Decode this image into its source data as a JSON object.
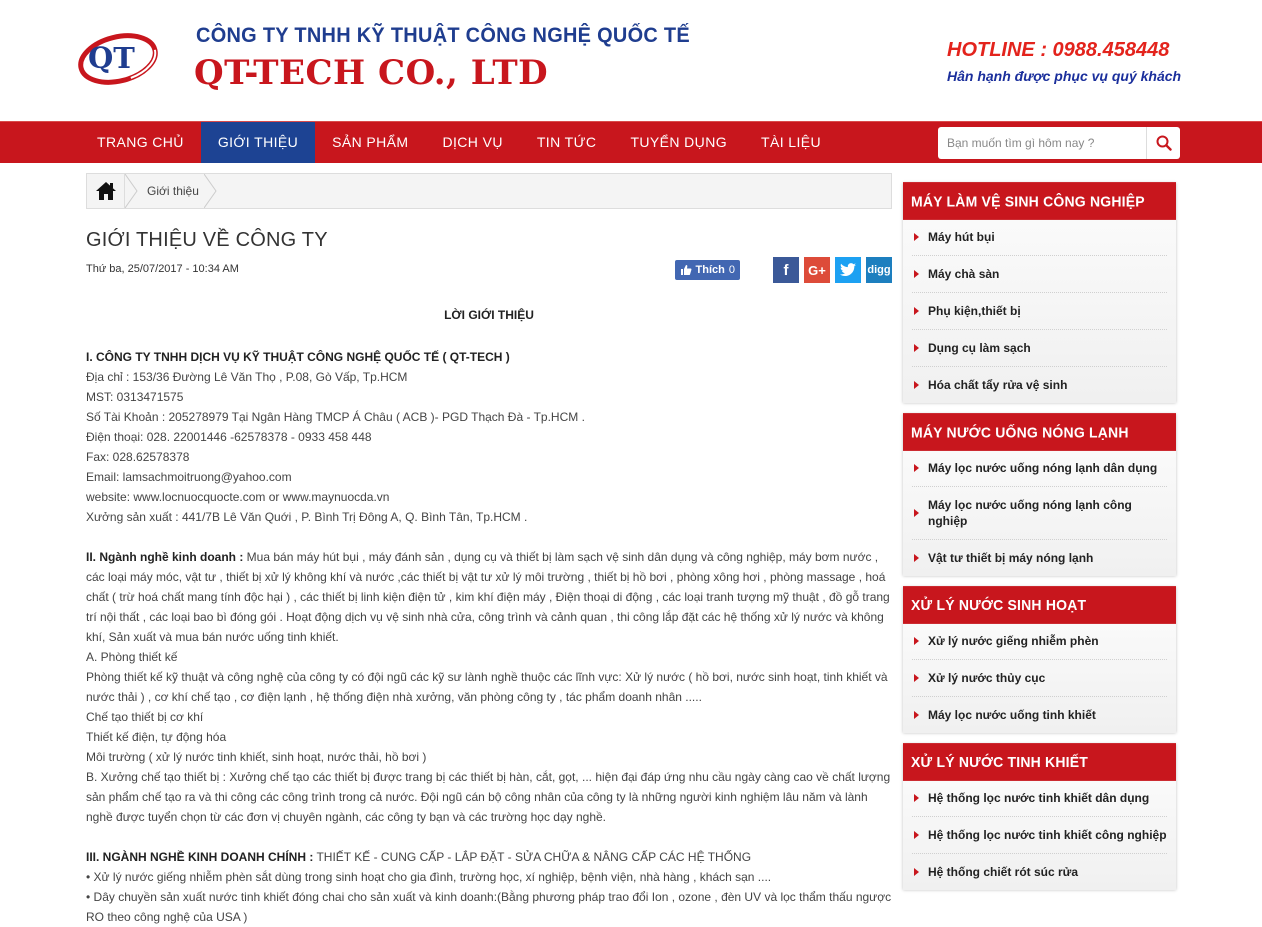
{
  "header": {
    "logo_text": "QT",
    "company_vn": "CÔNG TY TNHH KỸ THUẬT CÔNG NGHỆ QUỐC TẾ",
    "company_en": "QT-TECH CO., LTD",
    "hotline": "HOTLINE : 0988.458448",
    "slogan": "Hân hạnh được phục vụ quý khách"
  },
  "nav": {
    "items": [
      {
        "label": "TRANG CHỦ"
      },
      {
        "label": "GIỚI THIỆU"
      },
      {
        "label": "SẢN PHẨM"
      },
      {
        "label": "DỊCH VỤ"
      },
      {
        "label": "TIN TỨC"
      },
      {
        "label": "TUYỂN DỤNG"
      },
      {
        "label": "TÀI LIỆU"
      }
    ],
    "active_index": 1,
    "search_placeholder": "Bạn muốn tìm gì hôm nay ?"
  },
  "breadcrumb": {
    "current": "Giới thiệu"
  },
  "article": {
    "title": "GIỚI THIỆU VỀ CÔNG TY",
    "date": "Thứ ba, 25/07/2017 - 10:34 AM",
    "like_label": "Thích",
    "like_count": "0",
    "intro_heading": "LỜI GIỚI THIỆU",
    "section1_heading": "I. CÔNG TY TNHH DỊCH VỤ KỸ THUẬT CÔNG NGHỆ QUỐC TẾ  ( QT-TECH )",
    "address": "Địa chỉ :  153/36 Đường Lê Văn Thọ , P.08, Gò Vấp, Tp.HCM",
    "mst": "MST: 0313471575",
    "account": "Số Tài Khoản : 205278979 Tại Ngân Hàng TMCP Á Châu ( ACB )- PGD Thạch Đà - Tp.HCM .",
    "phone": "Điện thoại: 028.  22001446 -62578378 - 0933 458 448",
    "fax": "Fax: 028.62578378",
    "email": "Email: lamsachmoitruong@yahoo.com",
    "website": "website: www.locnuocquocte.com  or www.maynuocda.vn",
    "factory": "Xưởng sản xuất : 441/7B Lê Văn Quới , P. Bình Trị Đông A, Q. Bình Tân, Tp.HCM .",
    "section2_label": "II. Ngành nghề kinh doanh :",
    "section2_text": " Mua bán máy hút bụi , máy đánh sản , dụng cụ và thiết bị làm sạch vệ sinh dân dụng và công nghiệp, máy bơm nước , các loại  máy móc, vật tư , thiết bị xử lý không khí và nước ,các thiết bị vật tư xử lý môi trường , thiết bị hồ bơi , phòng xông hơi , phòng massage , hoá chất ( trừ hoá chất mang tính độc hại ) , các thiết bị linh kiện điện tử , kim khí điện máy , Điện thoại di động , các loại tranh tượng mỹ thuật , đồ gỗ trang trí nội thất , các loại bao bì đóng gói . Hoạt động dịch vụ vệ sinh nhà cửa, công trình và cảnh quan , thi công lắp đặt các hệ thống xử lý nước và không khí, Sản xuất và mua bán nước uống tinh khiết.",
    "a_heading": "A. Phòng thiết kế",
    "a_text": "Phòng thiết kế kỹ thuật và công nghệ của công ty có đội ngũ các kỹ sư lành nghề thuộc các lĩnh vực: Xử lý nước ( hồ bơi, nước sinh hoạt, tinh khiết và nước thải ) , cơ khí chế tạo , cơ điện lạnh , hệ thống điện nhà xưởng, văn phòng công ty , tác phẩm doanh nhân .....",
    "a_line2": "Chế tạo thiết bị cơ khí",
    "a_line3": "Thiết kế điện, tự động hóa",
    "a_line4": "Môi trường ( xử lý nước tinh khiết, sinh hoạt, nước thải, hồ bơi )",
    "b_text": "B. Xưởng chế tạo thiết bị : Xưởng chế tạo các thiết bị được trang bị các thiết bị hàn, cắt, gọt, ... hiện đại đáp ứng nhu cầu ngày càng cao về chất lượng sản phẩm chế tạo ra và thi công các công trình trong cả nước. Đội ngũ cán bộ công nhân của công ty là những người kinh nghiệm lâu năm và lành nghề được tuyển chọn từ các đơn vị chuyên ngành, các công ty bạn và các trường học dạy nghề.",
    "section3_label": "III. NGÀNH NGHỀ KINH DOANH CHÍNH :",
    "section3_text": " THIẾT KẾ - CUNG CẤP - LẮP ĐẶT - SỬA CHỮA & NÂNG CẤP CÁC HỆ THỐNG",
    "bullet1": "• Xử lý nước giếng nhiễm phèn sắt dùng trong sinh hoạt cho gia đình, trường học, xí nghiệp, bệnh viện, nhà hàng , khách sạn ....",
    "bullet2": "• Dây chuyền sản xuất nước tinh khiết đóng chai cho sản xuất và kinh doanh:(Bằng phương pháp trao đổi Ion , ozone , đèn UV và lọc thẩm thấu ngược RO theo công nghệ của USA )"
  },
  "sidebar": {
    "boxes": [
      {
        "title": "MÁY LÀM VỆ SINH CÔNG NGHIỆP",
        "items": [
          "Máy hút bụi",
          "Máy chà sàn",
          "Phụ kiện,thiết bị",
          "Dụng cụ làm sạch",
          "Hóa chất tẩy rửa vệ sinh"
        ]
      },
      {
        "title": "MÁY NƯỚC UỐNG NÓNG LẠNH",
        "items": [
          "Máy lọc nước uống nóng lạnh dân dụng",
          "Máy lọc nước uống nóng lạnh công nghiệp",
          "Vật tư thiết bị máy nóng lạnh"
        ]
      },
      {
        "title": "XỬ LÝ NƯỚC SINH HOẠT",
        "items": [
          "Xử lý nước giếng nhiễm phèn",
          "Xử lý nước thủy cục",
          "Máy lọc nước uống tinh khiết"
        ]
      },
      {
        "title": "XỬ LÝ NƯỚC TINH KHIẾT",
        "items": [
          "Hệ thống lọc nước tinh khiết dân dụng",
          "Hệ thống lọc nước tinh khiết công nghiệp",
          "Hệ thống chiết rót súc rửa"
        ]
      }
    ]
  },
  "colors": {
    "brand_red": "#c8161d",
    "brand_blue": "#1d4393"
  },
  "icons": {
    "home": "home-icon",
    "search": "search-icon",
    "like": "thumbs-up-icon"
  }
}
